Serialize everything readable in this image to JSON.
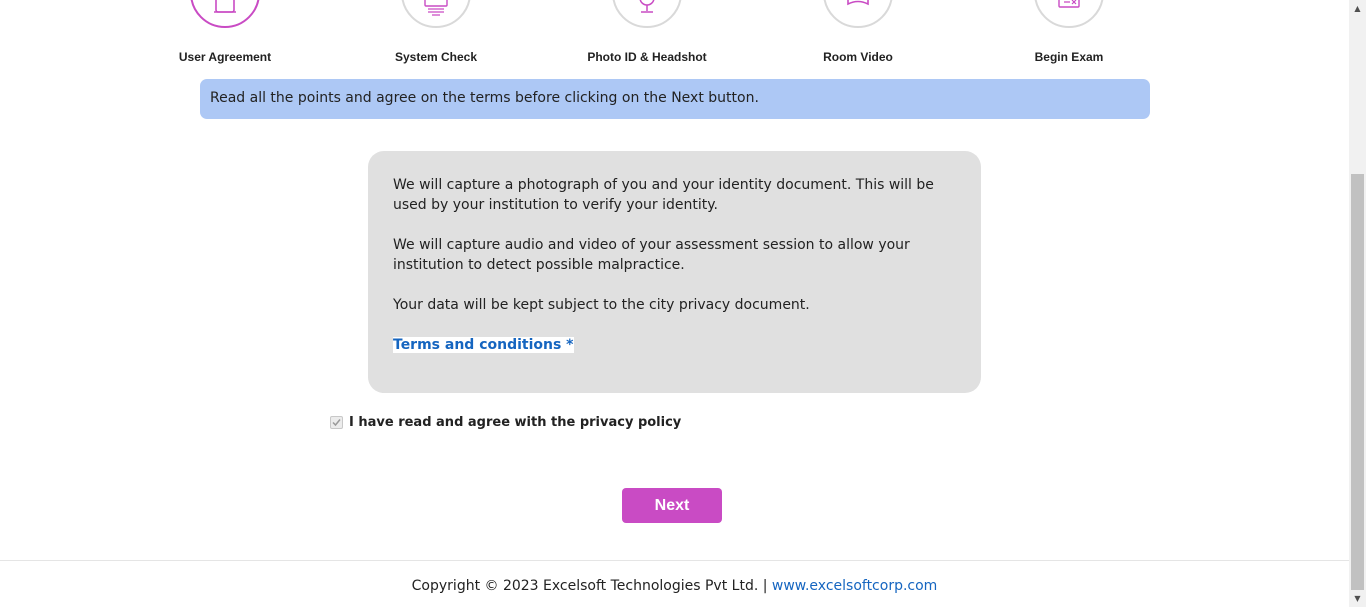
{
  "stepper": {
    "steps": [
      {
        "label": "User Agreement",
        "icon": "agreement-icon",
        "active": true
      },
      {
        "label": "System Check",
        "icon": "monitor-icon",
        "active": false
      },
      {
        "label": "Photo ID & Headshot",
        "icon": "webcam-icon",
        "active": false
      },
      {
        "label": "Room Video",
        "icon": "room-icon",
        "active": false
      },
      {
        "label": "Begin Exam",
        "icon": "exam-icon",
        "active": false
      }
    ],
    "active_color": "#c94bc4",
    "inactive_color": "#d9d9d9"
  },
  "banner": {
    "text": "Read all the points and agree on the terms before clicking on the Next button.",
    "color": "#adc8f5"
  },
  "privacy": {
    "paragraphs": [
      "We will capture a photograph of you and your identity document. This will be used by your institution to verify your identity.",
      "We will capture audio and video of your assessment session to allow your institution to detect possible malpractice.",
      "Your data will be kept subject to the city privacy document."
    ],
    "terms_link": "Terms and conditions *"
  },
  "agreement": {
    "label": "I have read and agree with the privacy policy",
    "checked": true,
    "disabled": true
  },
  "actions": {
    "next_label": "Next",
    "button_color": "#c94bc4"
  },
  "footer": {
    "copyright": "Copyright © 2023 Excelsoft Technologies Pvt Ltd. |",
    "link_text": "www.excelsoftcorp.com"
  },
  "scrollbar": {
    "up_icon": "scroll-up-arrow-icon",
    "down_icon": "scroll-down-arrow-icon"
  }
}
